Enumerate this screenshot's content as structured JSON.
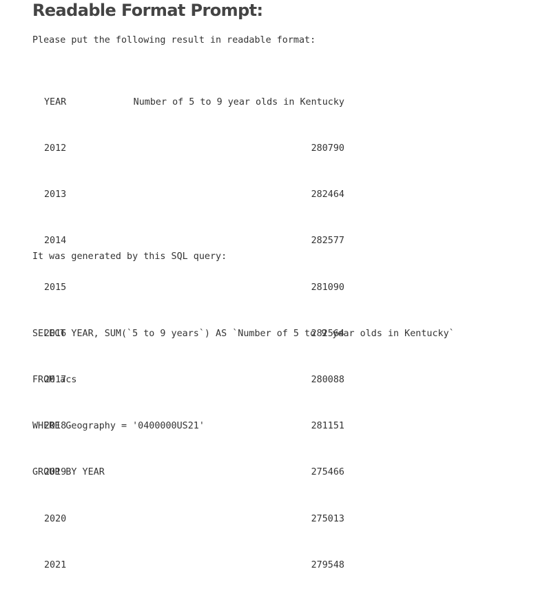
{
  "heading": "Readable Format Prompt:",
  "intro": "Please put the following result in readable format:",
  "table": {
    "headers": [
      "YEAR",
      "Number of 5 to 9 year olds in Kentucky"
    ],
    "rows": [
      [
        "2012",
        "280790"
      ],
      [
        "2013",
        "282464"
      ],
      [
        "2014",
        "282577"
      ],
      [
        "2015",
        "281090"
      ],
      [
        "2016",
        "282564"
      ],
      [
        "2017",
        "280088"
      ],
      [
        "2018",
        "281151"
      ],
      [
        "2019",
        "275466"
      ],
      [
        "2020",
        "275013"
      ],
      [
        "2021",
        "279548"
      ]
    ]
  },
  "generated_text": "It was generated by this SQL query:",
  "sql_lines": [
    "SELECT YEAR, SUM(`5 to 9 years`) AS `Number of 5 to 9 year olds in Kentucky`",
    "FROM acs",
    "WHERE Geography = '0400000US21'",
    "GROUP BY YEAR"
  ]
}
